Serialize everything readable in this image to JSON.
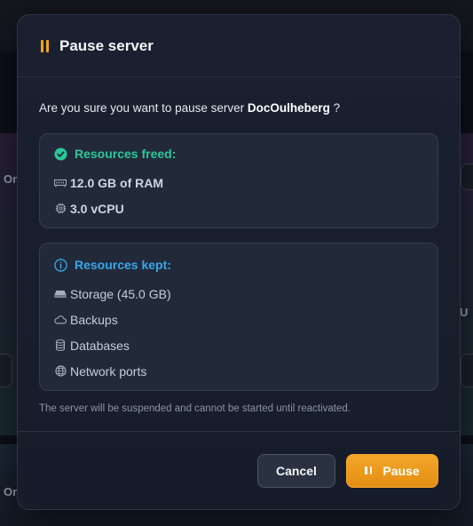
{
  "modal": {
    "title": "Pause server",
    "question_prefix": "Are you sure you want to pause server ",
    "server_name": "DocOulheberg",
    "question_suffix": " ?",
    "freed": {
      "heading": "Resources freed:",
      "items": [
        {
          "icon": "ram-icon",
          "label": "12.0 GB of RAM"
        },
        {
          "icon": "cpu-icon",
          "label": "3.0 vCPU"
        }
      ]
    },
    "kept": {
      "heading": "Resources kept:",
      "items": [
        {
          "icon": "storage-icon",
          "label": "Storage (45.0 GB)"
        },
        {
          "icon": "cloud-icon",
          "label": "Backups"
        },
        {
          "icon": "database-icon",
          "label": "Databases"
        },
        {
          "icon": "globe-icon",
          "label": "Network ports"
        }
      ]
    },
    "note": "The server will be suspended and cannot be started until reactivated.",
    "cancel_label": "Cancel",
    "pause_label": "Pause"
  },
  "background": {
    "left_fragment_1": "Or",
    "left_fragment_2": "Or",
    "right_fragment": "U"
  },
  "colors": {
    "accent": "#f0a41e",
    "success": "#2cc79a",
    "info": "#3aa6ea"
  }
}
